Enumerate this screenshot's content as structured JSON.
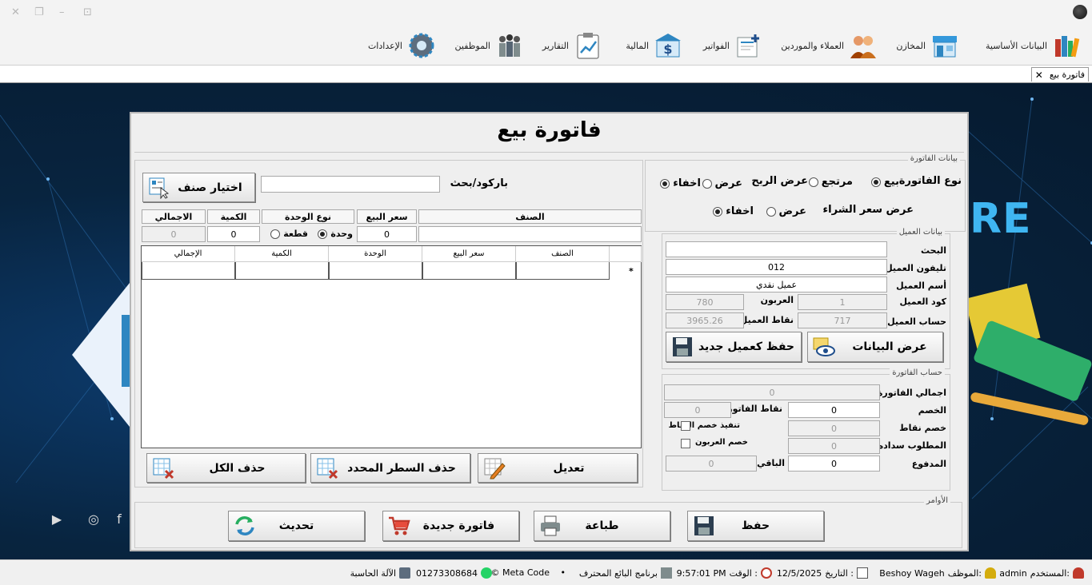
{
  "ribbon": {
    "items": [
      {
        "label": "البيانات الأساسية",
        "icon": "books-icon"
      },
      {
        "label": "المخازن",
        "icon": "store-icon"
      },
      {
        "label": "العملاء والموردين",
        "icon": "people-icon"
      },
      {
        "label": "الفواتير",
        "icon": "invoice-icon"
      },
      {
        "label": "المالية",
        "icon": "bank-icon"
      },
      {
        "label": "التقارير",
        "icon": "chart-clipboard-icon"
      },
      {
        "label": "الموظفين",
        "icon": "employees-icon"
      },
      {
        "label": "الإعدادات",
        "icon": "gear-icon"
      }
    ]
  },
  "tab": {
    "label": "فاتورة بيع",
    "close": "✕"
  },
  "background": {
    "text": "RE"
  },
  "form": {
    "title": "فاتورة بيع",
    "invoice_data": {
      "legend": "بيانات الفاتورة",
      "type_label": "نوع الفاتورة",
      "type_sale": "بيع",
      "type_return": "مرتجع",
      "profit_label": "عرض الربح",
      "show": "عرض",
      "hide": "اخفاء",
      "purchase_label": "عرض سعر الشراء"
    },
    "customer": {
      "legend": "بيانات العميل",
      "search_label": "البحث",
      "search_value": "",
      "phone_label": "تليفون العميل",
      "phone_value": "012",
      "name_label": "أسم العميل",
      "name_value": "عميل نقدي",
      "code_label": "كود العميل",
      "code_value": "1",
      "deposit_label": "العربون",
      "deposit_value": "780",
      "account_label": "حساب العميل",
      "account_value": "717",
      "points_label": "نقاط العميل",
      "points_value": "3965.26",
      "show_data_button": "عرض البيانات",
      "save_new_button": "حفظ كعميل جديد"
    },
    "invoice_account": {
      "legend": "حساب الفاتورة",
      "total_label": "اجمالي الفاتورة",
      "total_value": "0",
      "discount_label": "الخصم",
      "discount_value": "0",
      "invoice_points_label": "نقاط الفاتورة",
      "invoice_points_value": "0",
      "points_discount_label": "خصم نقاط",
      "points_discount_value": "0",
      "apply_points_label": "تنفيذ خصم النقاط",
      "deposit_discount_label": "خصم العربون",
      "due_label": "المطلوب سداده",
      "due_value": "0",
      "paid_label": "المدفوع",
      "paid_value": "0",
      "remaining_label": "الباقي",
      "remaining_value": "0"
    },
    "items": {
      "barcode_label": "باركود/بحث",
      "barcode_value": "",
      "choose_item_button": "اختيار صنف",
      "h_item": "الصنف",
      "h_price": "سعر البيع",
      "h_unit_type": "نوع الوحدة",
      "h_qty": "الكمية",
      "h_total": "الاجمالي",
      "price_value": "0",
      "qty_value": "0",
      "total_value": "0",
      "unit_opt_unit": "وحدة",
      "unit_opt_piece": "قطعة",
      "grid_headers": [
        "الصنف",
        "سعر البيع",
        "الوحدة",
        "الكمية",
        "الإجمالي"
      ],
      "new_row_marker": "*",
      "edit_button": "تعديل",
      "delete_selected_button": "حذف السطر المحدد",
      "delete_all_button": "حذف الكل"
    },
    "commands": {
      "legend": "الأوامر",
      "save_button": "حفظ",
      "print_button": "طباعة",
      "new_invoice_button": "فاتورة جديدة",
      "refresh_button": "تحديث"
    }
  },
  "status": {
    "user_label": "المستخدم:",
    "user_value": "admin",
    "employee_label": "الموظف:",
    "employee_value": "Beshoy Wageh",
    "date_label": "التاريخ :",
    "date_value": "12/5/2025",
    "time_label": "الوقت :",
    "time_value": "9:57:01 PM",
    "program": "برنامج البائع المحترف",
    "dot": "•",
    "brand": "© Meta Code",
    "phone": "01273308684",
    "calculator": "الآلة الحاسبة"
  },
  "colors": {
    "accent_blue": "#3fb6f2",
    "stage_dark": "#08243f"
  }
}
